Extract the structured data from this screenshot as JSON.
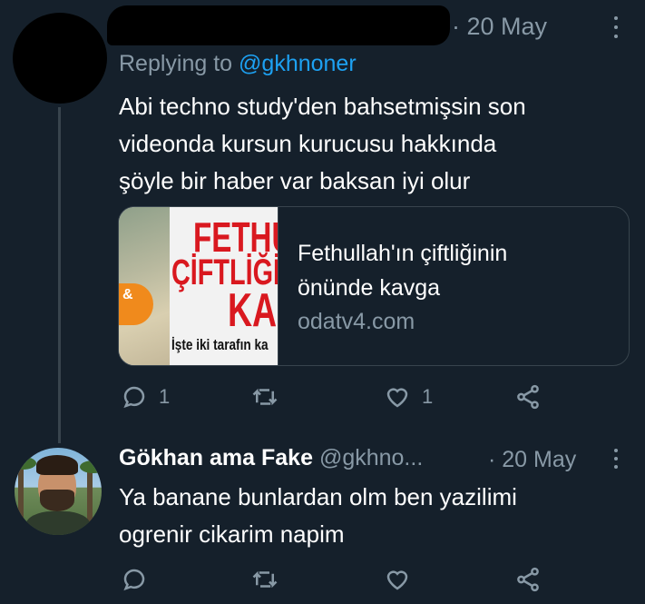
{
  "tweet1": {
    "date": "· 20 May",
    "replying_prefix": "Replying to",
    "replying_handle": "@gkhnoner",
    "text": "Abi techno study'den bahsetmişsin son\nvideonda kursun kurucusu hakkında\nşöyle bir haber var baksan iyi olur",
    "card": {
      "thumb_line1": "FETHU",
      "thumb_line2": "ÇİFTLİĞİN",
      "thumb_line3": "KA",
      "thumb_line4": "İşte iki tarafın ka",
      "thumb_amp": "&",
      "title": "Fethullah'ın çiftliğinin\nönünde kavga",
      "domain": "odatv4.com"
    },
    "actions": {
      "reply_count": "1",
      "retweet_count": "",
      "like_count": "1"
    }
  },
  "tweet2": {
    "display_name": "Gökhan ama Fake",
    "handle": "@gkhno...",
    "date": "· 20 May",
    "text": "Ya banane bunlardan olm ben yazilimi\nogrenir cikarim napim",
    "actions": {
      "reply_count": "",
      "retweet_count": "",
      "like_count": ""
    }
  },
  "icons": [
    "reply-icon",
    "retweet-icon",
    "like-icon",
    "share-icon",
    "more-icon"
  ],
  "colors": {
    "background": "#15202b",
    "secondary_text": "#8899a6",
    "link": "#1da1f2",
    "border": "#38444d"
  }
}
